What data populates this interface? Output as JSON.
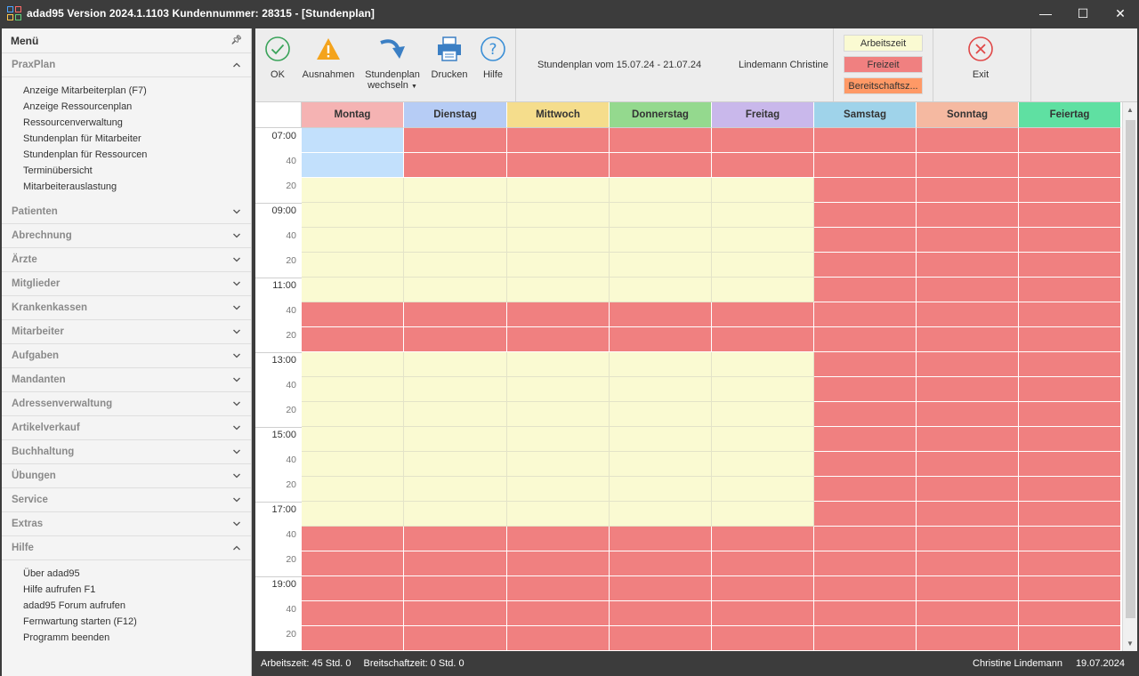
{
  "window": {
    "title": "adad95  Version 2024.1.1103  Kundennummer: 28315 - [Stundenplan]",
    "controls": {
      "minimize": "—",
      "maximize": "☐",
      "close": "✕"
    }
  },
  "sidebar": {
    "header": "Menü",
    "sections": [
      {
        "label": "PraxPlan",
        "expanded": true,
        "items": [
          "Anzeige Mitarbeiterplan (F7)",
          "Anzeige Ressourcenplan",
          "Ressourcenverwaltung",
          "Stundenplan für Mitarbeiter",
          "Stundenplan für Ressourcen",
          "Terminübersicht",
          "Mitarbeiterauslastung"
        ]
      },
      {
        "label": "Patienten"
      },
      {
        "label": "Abrechnung"
      },
      {
        "label": "Ärzte"
      },
      {
        "label": "Mitglieder"
      },
      {
        "label": "Krankenkassen"
      },
      {
        "label": "Mitarbeiter"
      },
      {
        "label": "Aufgaben"
      },
      {
        "label": "Mandanten"
      },
      {
        "label": "Adressenverwaltung"
      },
      {
        "label": "Artikelverkauf"
      },
      {
        "label": "Buchhaltung"
      },
      {
        "label": "Übungen"
      },
      {
        "label": "Service"
      },
      {
        "label": "Extras"
      },
      {
        "label": "Hilfe",
        "expanded": true,
        "items": [
          "Über adad95",
          "Hilfe aufrufen F1",
          "adad95 Forum aufrufen",
          "Fernwartung starten (F12)",
          "Programm beenden"
        ]
      }
    ]
  },
  "toolbar": {
    "ok": "OK",
    "ausnahmen": "Ausnahmen",
    "stundenplan_line1": "Stundenplan",
    "stundenplan_line2": "wechseln",
    "drucken": "Drucken",
    "hilfe": "Hilfe",
    "range": "Stundenplan vom 15.07.24 - 21.07.24",
    "person": "Lindemann Christine",
    "legend": {
      "arbeitszeit": "Arbeitszeit",
      "freizeit": "Freizeit",
      "bereitschaft": "Bereitschaftsz..."
    },
    "exit": "Exit"
  },
  "colors": {
    "work": "#fafad2",
    "free": "#f08080",
    "selected": "#c2e0fc",
    "bereitschaft": "#ff9966"
  },
  "schedule": {
    "days": [
      {
        "name": "Montag",
        "color": "#f5b3b3"
      },
      {
        "name": "Dienstag",
        "color": "#b6ccf5"
      },
      {
        "name": "Mittwoch",
        "color": "#f5dd8c"
      },
      {
        "name": "Donnerstag",
        "color": "#94d98e"
      },
      {
        "name": "Freitag",
        "color": "#c9b8eb"
      },
      {
        "name": "Samstag",
        "color": "#9fd3ea"
      },
      {
        "name": "Sonntag",
        "color": "#f5b9a1"
      },
      {
        "name": "Feiertag",
        "color": "#5fe0a2"
      }
    ],
    "times": [
      "07:00",
      "40",
      "20",
      "09:00",
      "40",
      "20",
      "11:00",
      "40",
      "20",
      "13:00",
      "40",
      "20",
      "15:00",
      "40",
      "20",
      "17:00",
      "40",
      "20",
      "19:00",
      "40",
      "20"
    ],
    "rows": [
      [
        "s",
        "f",
        "f",
        "f",
        "f",
        "f",
        "f",
        "f"
      ],
      [
        "s",
        "f",
        "f",
        "f",
        "f",
        "f",
        "f",
        "f"
      ],
      [
        "w",
        "w",
        "w",
        "w",
        "w",
        "f",
        "f",
        "f"
      ],
      [
        "w",
        "w",
        "w",
        "w",
        "w",
        "f",
        "f",
        "f"
      ],
      [
        "w",
        "w",
        "w",
        "w",
        "w",
        "f",
        "f",
        "f"
      ],
      [
        "w",
        "w",
        "w",
        "w",
        "w",
        "f",
        "f",
        "f"
      ],
      [
        "w",
        "w",
        "w",
        "w",
        "w",
        "f",
        "f",
        "f"
      ],
      [
        "f",
        "f",
        "f",
        "f",
        "f",
        "f",
        "f",
        "f"
      ],
      [
        "f",
        "f",
        "f",
        "f",
        "f",
        "f",
        "f",
        "f"
      ],
      [
        "w",
        "w",
        "w",
        "w",
        "w",
        "f",
        "f",
        "f"
      ],
      [
        "w",
        "w",
        "w",
        "w",
        "w",
        "f",
        "f",
        "f"
      ],
      [
        "w",
        "w",
        "w",
        "w",
        "w",
        "f",
        "f",
        "f"
      ],
      [
        "w",
        "w",
        "w",
        "w",
        "w",
        "f",
        "f",
        "f"
      ],
      [
        "w",
        "w",
        "w",
        "w",
        "w",
        "f",
        "f",
        "f"
      ],
      [
        "w",
        "w",
        "w",
        "w",
        "w",
        "f",
        "f",
        "f"
      ],
      [
        "w",
        "w",
        "w",
        "w",
        "w",
        "f",
        "f",
        "f"
      ],
      [
        "f",
        "f",
        "f",
        "f",
        "f",
        "f",
        "f",
        "f"
      ],
      [
        "f",
        "f",
        "f",
        "f",
        "f",
        "f",
        "f",
        "f"
      ],
      [
        "f",
        "f",
        "f",
        "f",
        "f",
        "f",
        "f",
        "f"
      ],
      [
        "f",
        "f",
        "f",
        "f",
        "f",
        "f",
        "f",
        "f"
      ],
      [
        "f",
        "f",
        "f",
        "f",
        "f",
        "f",
        "f",
        "f"
      ]
    ]
  },
  "status": {
    "arbeitszeit": "Arbeitszeit: 45 Std. 0",
    "bereitschaft": "Breitschaftzeit: 0 Std. 0",
    "user": "Christine Lindemann",
    "date": "19.07.2024"
  }
}
